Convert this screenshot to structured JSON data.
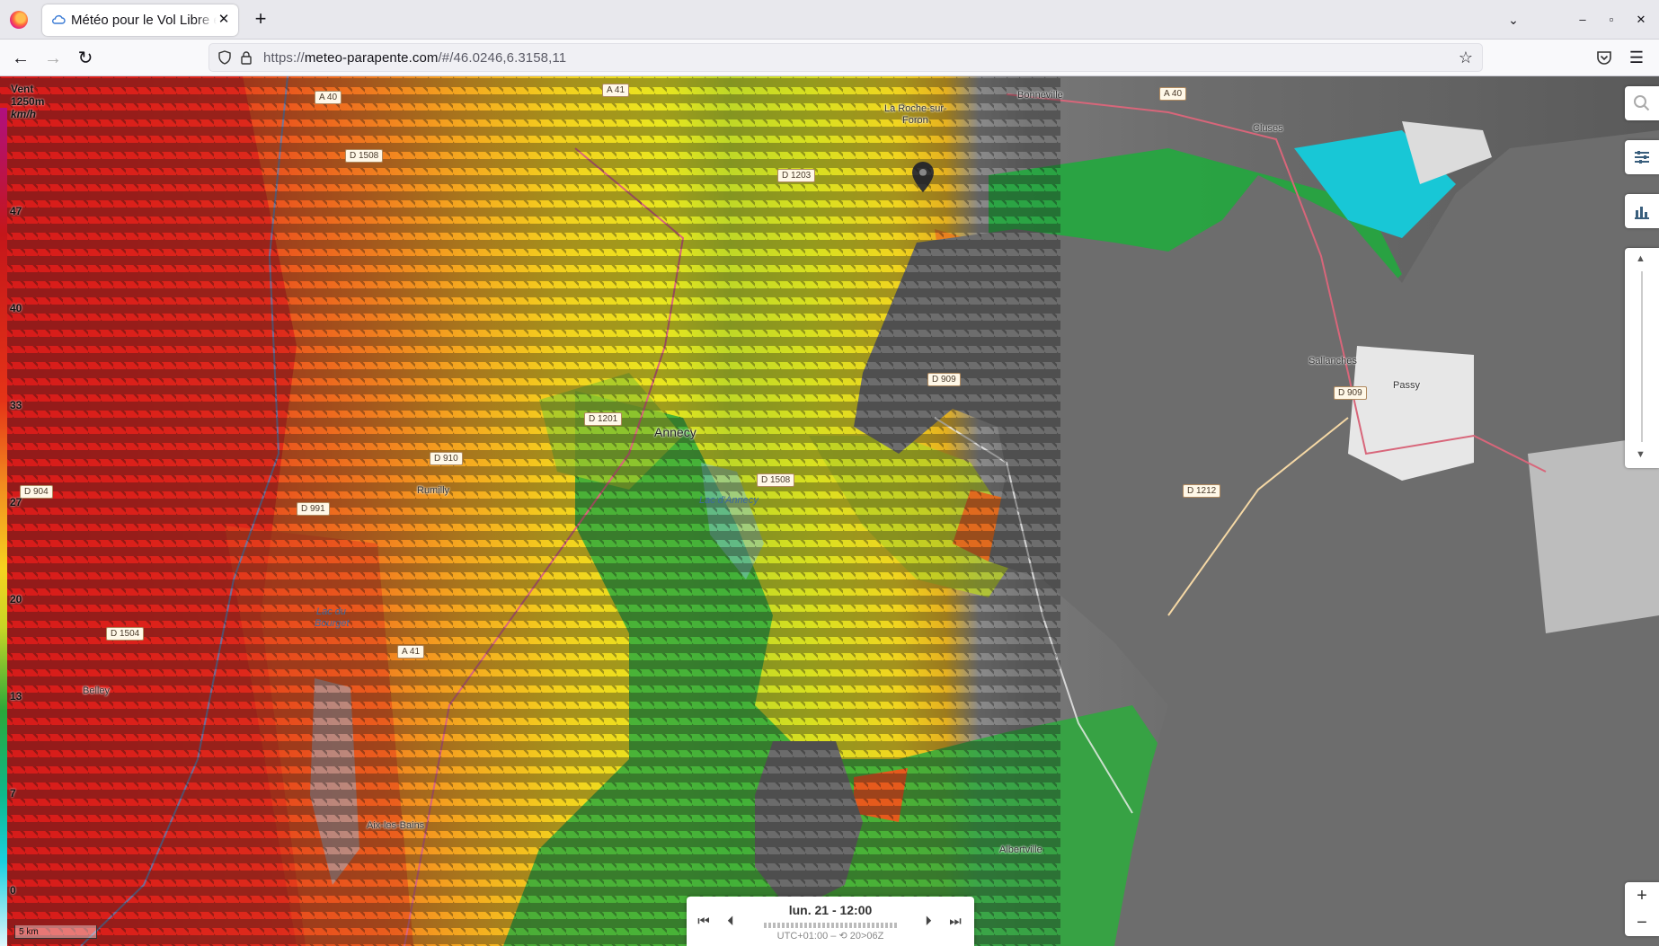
{
  "browser": {
    "tab_title": "Météo pour le Vol Libre et",
    "tab_close": "✕",
    "new_tab": "+",
    "url_prefix": "https://",
    "url_host": "meteo-parapente.com",
    "url_path": "/#/46.0246,6.3158,11"
  },
  "legend": {
    "title_line1": "Vent",
    "title_line2": "1250m",
    "unit": "km/h",
    "values": [
      "47",
      "40",
      "33",
      "27",
      "20",
      "13",
      "7",
      "0"
    ]
  },
  "map": {
    "places": [
      "Annecy",
      "Rumilly",
      "Belley",
      "Aix-les-Bains",
      "Albertville",
      "Sallanches",
      "Passy",
      "Cluses",
      "Bonneville",
      "La Roche-sur-",
      "Foron"
    ],
    "roads": [
      "A 40",
      "A 41",
      "D 1508",
      "D 1203",
      "D 909",
      "D 1201",
      "D 910",
      "D 904",
      "D 991",
      "D 1508",
      "D 1504",
      "A 41",
      "A 40",
      "D 909",
      "D 1212"
    ],
    "lakes": [
      "Lac d'Annecy",
      "Lac du",
      "Bourget"
    ],
    "scale": "5 km"
  },
  "timebar": {
    "date": "lun. 21 - 12:00",
    "timezone": "UTC+01:00 – ⟲ 20>06Z"
  },
  "controls": {
    "zoom_in": "+",
    "zoom_out": "−",
    "slider_up": "▲",
    "slider_down": "▼"
  }
}
